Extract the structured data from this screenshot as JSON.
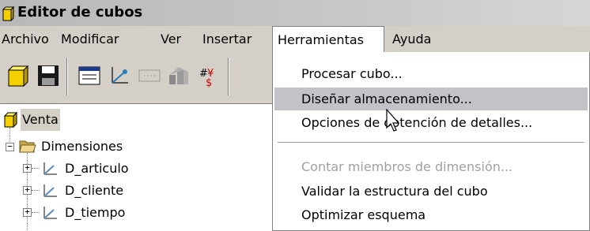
{
  "window": {
    "title": "Editor de cubos"
  },
  "menubar": {
    "items": [
      "Archivo",
      "Modificar",
      "Ver",
      "Insertar",
      "Herramientas",
      "Ayuda"
    ],
    "open_item": "Herramientas"
  },
  "toolbar": {
    "buttons": [
      "cube-icon",
      "save-icon",
      "grid-icon",
      "dimension-icon",
      "table-icon",
      "chart-icon",
      "format-icon"
    ]
  },
  "tree": {
    "root": "Venta",
    "group": "Dimensiones",
    "children": [
      "D_articulo",
      "D_cliente",
      "D_tiempo"
    ]
  },
  "dropdown": {
    "items": [
      {
        "label": "Procesar cubo...",
        "state": "normal"
      },
      {
        "label": "Diseñar almacenamiento...",
        "state": "hover"
      },
      {
        "label": "Opciones de obtención de detalles...",
        "state": "normal"
      },
      {
        "label": "Contar miembros de dimensión...",
        "state": "disabled"
      },
      {
        "label": "Validar la estructura del cubo",
        "state": "normal"
      },
      {
        "label": "Optimizar esquema",
        "state": "normal"
      }
    ]
  },
  "colors": {
    "hover": "#c2c2c8",
    "disabled_text": "#a0a0a0",
    "cube_yellow": "#f4d000",
    "folder": "#e8c86a"
  }
}
